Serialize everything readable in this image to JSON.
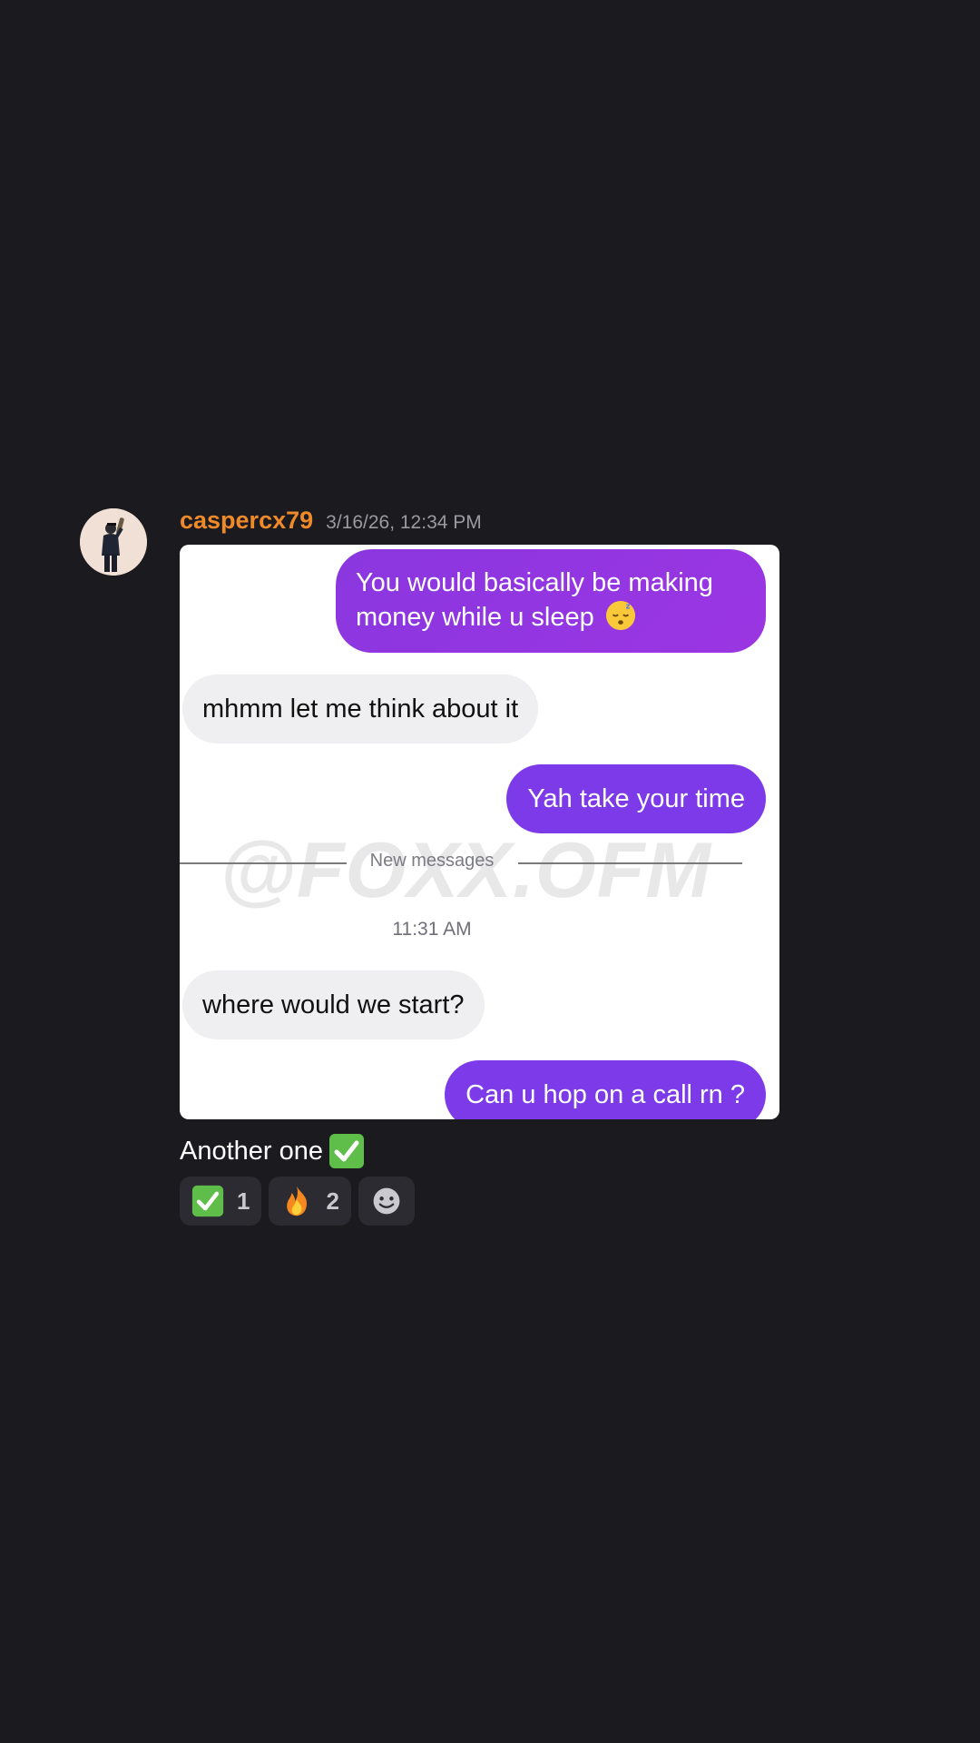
{
  "message": {
    "username": "caspercx79",
    "timestamp": "3/16/26, 12:34 PM",
    "caption": "Another one",
    "caption_emoji": "white-check-mark-emoji"
  },
  "embed": {
    "watermark": "@FOXX.OFM",
    "bubbles": [
      {
        "direction": "outgoing",
        "text": "You would basically be making money while u sleep",
        "emoji": "sleeping-face-emoji"
      },
      {
        "direction": "incoming",
        "text": "mhmm let me think about it"
      },
      {
        "direction": "outgoing",
        "text": "Yah take your time"
      },
      {
        "direction": "incoming",
        "text": "where would we start?"
      },
      {
        "direction": "outgoing",
        "text": "Can u hop on a call rn ?"
      }
    ],
    "divider_label": "New messages",
    "time_label": "11:31 AM"
  },
  "reactions": [
    {
      "emoji": "white-check-mark-emoji",
      "count": "1"
    },
    {
      "emoji": "fire-emoji",
      "count": "2"
    },
    {
      "emoji": "add-reaction-icon",
      "count": ""
    }
  ],
  "colors": {
    "background": "#1b1a1f",
    "username": "#ef8a2b",
    "outgoing_bubble": "#8a3be6",
    "incoming_bubble": "#efeff1",
    "reaction_bg": "#2b2b31"
  }
}
